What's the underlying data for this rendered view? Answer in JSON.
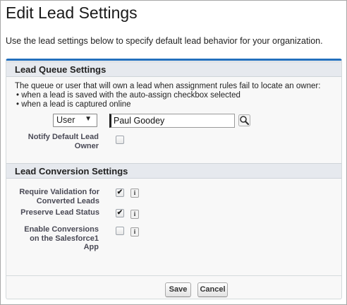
{
  "page": {
    "title": "Edit Lead Settings",
    "intro": "Use the lead settings below to specify default lead behavior for your organization."
  },
  "queue_section": {
    "header": "Lead Queue Settings",
    "description": "The queue or user that will own a lead when assignment rules fail to locate an owner:",
    "bullet_1": "• when a lead is saved with the auto-assign checkbox selected",
    "bullet_2": "• when a lead is captured online",
    "owner_type": {
      "selected": "User",
      "arrow": "▼"
    },
    "owner_name": "Paul Goodey",
    "lookup_icon": "magnifier-icon",
    "notify": {
      "label_line1": "Notify Default Lead",
      "label_line2": "Owner",
      "checked": false,
      "mark": ""
    }
  },
  "conversion_section": {
    "header": "Lead Conversion Settings",
    "require_validation": {
      "label_line1": "Require Validation for",
      "label_line2": "Converted Leads",
      "checked": true,
      "mark": "✔",
      "info": "i"
    },
    "preserve_status": {
      "label_line1": "Preserve Lead Status",
      "checked": true,
      "mark": "✔",
      "info": "i"
    },
    "enable_conversions": {
      "label_line1": "Enable Conversions",
      "label_line2": "on the Salesforce1",
      "label_line3": "App",
      "checked": false,
      "mark": "",
      "info": "i"
    }
  },
  "buttons": {
    "save": "Save",
    "cancel": "Cancel"
  },
  "colors": {
    "accent": "#236fbd",
    "section_bg": "#e6e9ee",
    "panel_bg": "#f8f8f8"
  }
}
